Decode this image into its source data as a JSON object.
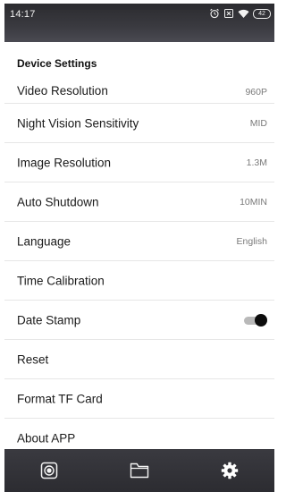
{
  "status_bar": {
    "time": "14:17",
    "battery": "42",
    "icons": [
      "alarm-icon",
      "sim-blocked-icon",
      "wifi-icon",
      "battery-icon"
    ]
  },
  "settings": {
    "section_title": "Device Settings",
    "items": [
      {
        "label": "Video Resolution",
        "value": "960P"
      },
      {
        "label": "Night Vision Sensitivity",
        "value": "MID"
      },
      {
        "label": "Image Resolution",
        "value": "1.3M"
      },
      {
        "label": "Auto Shutdown",
        "value": "10MIN"
      },
      {
        "label": "Language",
        "value": "English"
      },
      {
        "label": "Time Calibration",
        "value": ""
      },
      {
        "label": "Date Stamp",
        "toggle": "on"
      },
      {
        "label": "Reset",
        "value": ""
      },
      {
        "label": "Format TF Card",
        "value": ""
      },
      {
        "label": "About APP",
        "value": ""
      }
    ]
  },
  "bottom_nav": {
    "items": [
      "camera-lens-icon",
      "folder-icon",
      "gear-icon"
    ],
    "active": "gear-icon"
  },
  "colors": {
    "status_bar_bg": "#2b2b2f",
    "nav_bg": "#333338",
    "toggle_knob": "#0c0c0c",
    "toggle_track": "#b9b9b9",
    "value_text": "#7a7a7a"
  }
}
